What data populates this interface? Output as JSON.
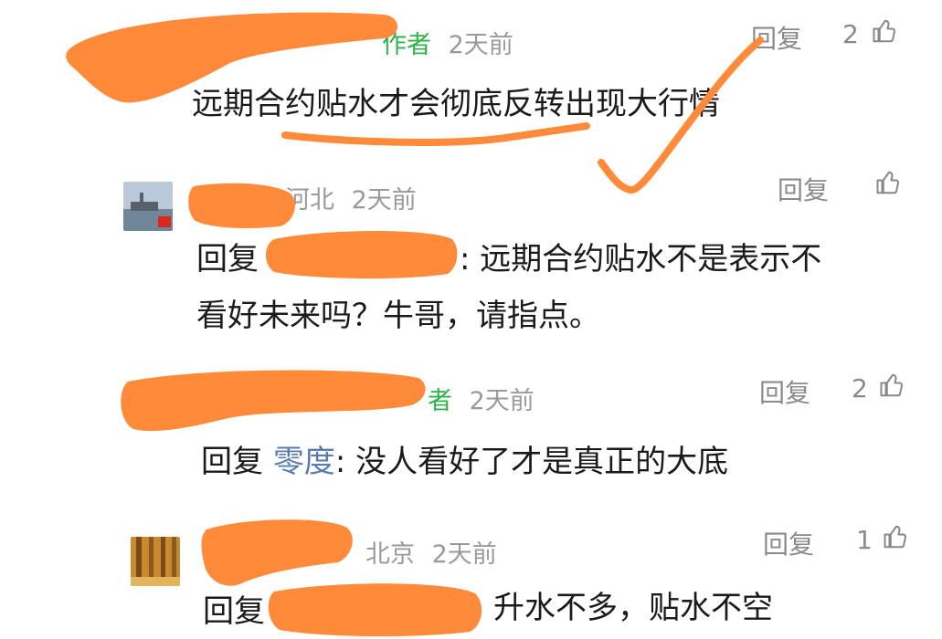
{
  "comments": [
    {
      "author_tag": "作者",
      "time": "2天前",
      "text": "远期合约贴水才会彻底反转出现大行情",
      "reply_label": "回复",
      "likes": "2"
    },
    {
      "region": "河北",
      "time": "2天前",
      "reply_prefix": "回复",
      "text_tail": ": 远期合约贴水不是表示不",
      "text_line2": "看好未来吗？牛哥，请指点。",
      "reply_label": "回复",
      "likes": ""
    },
    {
      "author_tag": "者",
      "time": "2天前",
      "reply_prefix": "回复",
      "reply_to": "零度",
      "text": ": 没人看好了才是真正的大底",
      "reply_label": "回复",
      "likes": "2"
    },
    {
      "region": "北京",
      "time": "2天前",
      "reply_prefix": "回复",
      "text_tail": "升水不多，贴水不空",
      "reply_label": "回复",
      "likes": "1"
    }
  ],
  "colors": {
    "redaction": "#ff8a3a",
    "author_green": "#2fb24a",
    "meta_gray": "#9a9a9a"
  }
}
